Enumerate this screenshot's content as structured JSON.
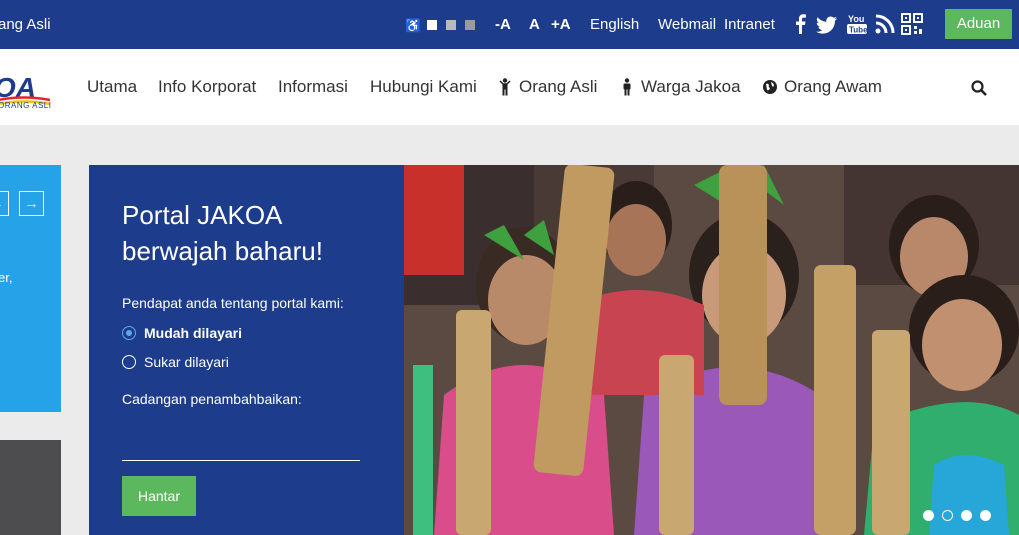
{
  "topbar": {
    "brand_fragment": "ang Asli",
    "font_small": "-A",
    "font_normal": "A",
    "font_large": "+A",
    "language": "English",
    "webmail": "Webmail",
    "intranet": "Intranet",
    "aduan": "Aduan",
    "social_icons": [
      "facebook-icon",
      "twitter-icon",
      "youtube-icon",
      "rss-icon",
      "qr-code-icon"
    ],
    "contrast_colors": [
      "#ffffff",
      "#b9b9b9",
      "#9b9b9b"
    ]
  },
  "logo": {
    "fragment_text": "OA",
    "subtitle": "ORANG ASLI"
  },
  "nav": {
    "items": [
      {
        "label": "Utama"
      },
      {
        "label": "Info Korporat"
      },
      {
        "label": "Informasi"
      },
      {
        "label": "Hubungi Kami"
      },
      {
        "label": "Orang Asli",
        "icon": "person-icon"
      },
      {
        "label": "Warga Jakoa",
        "icon": "person-icon"
      },
      {
        "label": "Orang Awam",
        "icon": "globe-icon"
      }
    ]
  },
  "left_panel": {
    "text_fragment": "er,"
  },
  "poll": {
    "title": "Portal JAKOA berwajah baharu!",
    "question": "Pendapat anda tentang portal kami:",
    "options": [
      {
        "label": "Mudah dilayari",
        "selected": true
      },
      {
        "label": "Sukar dilayari",
        "selected": false
      }
    ],
    "suggestion_label": "Cadangan penambahbaikan:",
    "suggestion_value": "",
    "submit": "Hantar"
  },
  "slider": {
    "dot_count": 4,
    "active_index": 1
  },
  "colors": {
    "primary_blue": "#1e3c8c",
    "accent_green": "#5cb85c",
    "light_blue": "#26a3e8"
  }
}
